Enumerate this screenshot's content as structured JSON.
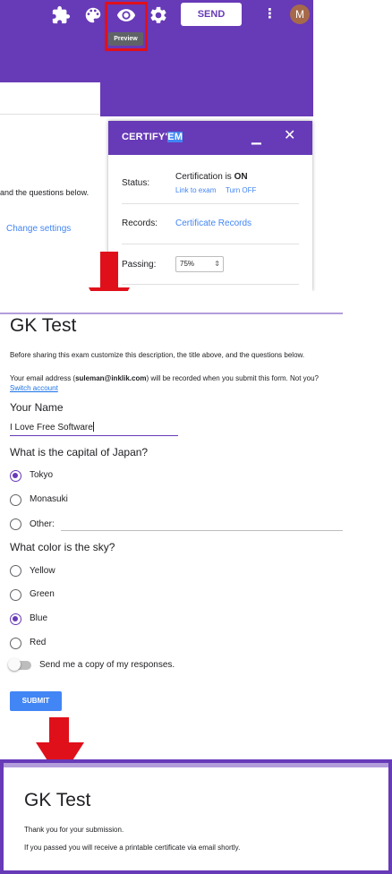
{
  "editor": {
    "send_label": "SEND",
    "avatar_letter": "M",
    "preview_tooltip": "Preview",
    "description_fragment": "and the questions below.",
    "change_settings": "Change settings",
    "icons": [
      "puzzle-icon",
      "palette-icon",
      "eye-icon",
      "gear-icon",
      "more-vert-icon"
    ],
    "colors": {
      "brand": "#673ab7",
      "highlight": "#e0101a"
    }
  },
  "certify": {
    "title_main": "CERTIFY'",
    "title_hl": "EM",
    "status_label": "Status:",
    "status_text": "Certification is ",
    "status_value": "ON",
    "link_to_exam": "Link to exam",
    "turn_off": "Turn OFF",
    "records_label": "Records:",
    "records_link": "Certificate Records",
    "passing_label": "Passing:",
    "passing_value": "75%"
  },
  "preview": {
    "title": "GK Test",
    "description": "Before sharing this exam customize this description, the title above, and the questions below.",
    "email_prefix": "Your email address (",
    "email": "suleman@inklik.com",
    "email_suffix": ") will be recorded when you submit this form. Not you?",
    "switch_account": "Switch account",
    "q1": {
      "label": "Your Name",
      "value": "I Love Free Software"
    },
    "q2": {
      "label": "What is the capital of Japan?",
      "options": [
        "Tokyo",
        "Monasuki",
        "Other:"
      ],
      "selected": "Tokyo"
    },
    "q3": {
      "label": "What color is the sky?",
      "options": [
        "Yellow",
        "Green",
        "Blue",
        "Red"
      ],
      "selected": "Blue"
    },
    "copy_toggle": "Send me a copy of my responses.",
    "submit": "SUBMIT"
  },
  "thanks": {
    "title": "GK Test",
    "line1": "Thank you for your submission.",
    "line2": "If you passed you will receive a printable certificate via email shortly."
  }
}
